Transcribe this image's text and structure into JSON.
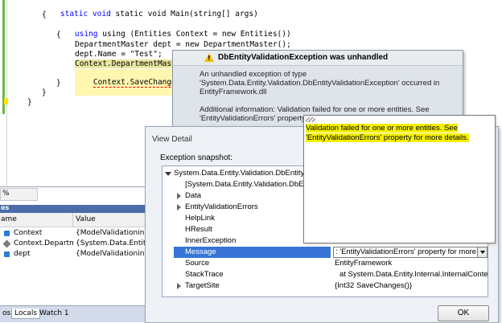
{
  "code": {
    "lines": [
      "static void Main(string[] args)",
      "{",
      "using (Entities Context = new Entities())",
      "{",
      "DepartmentMaster dept = new DepartmentMaster();",
      "dept.Name = \"Test\";",
      "Context.DepartmentMasters.Ad",
      "Context.SaveChanges();",
      "}",
      "}",
      "}"
    ]
  },
  "exception_helper": {
    "title": "DbEntityValidationException was unhandled",
    "line1": "An unhandled exception of type",
    "line2": "'System.Data.Entity.Validation.DbEntityValidationException' occurred in",
    "line3": "EntityFramework.dll",
    "line4": "Additional information: Validation failed for one or more entities. See",
    "line5": "'EntityValidationErrors' property f"
  },
  "locals": {
    "zoom": "%",
    "panel_title": "os",
    "col_name": "ame",
    "col_value": "Value",
    "rows": [
      {
        "name": "Context",
        "value": "{ModelValidationinEF("
      },
      {
        "name": "Context.Departmer",
        "value": "{System.Data.Entity.Db"
      },
      {
        "name": "dept",
        "value": "{ModelValidationinEF("
      }
    ],
    "tabs": [
      "os",
      "Locals",
      "Watch 1"
    ]
  },
  "view_detail": {
    "caption": "View Detail",
    "snapshot_label": "Exception snapshot:",
    "tree": [
      {
        "key": "System.Data.Entity.Validation.DbEntityValidat",
        "value": ""
      },
      {
        "key": "[System.Data.Entity.Validation.DbEnti",
        "value": ""
      },
      {
        "key": "Data",
        "value": ""
      },
      {
        "key": "EntityValidationErrors",
        "value": ""
      },
      {
        "key": "HelpLink",
        "value": ""
      },
      {
        "key": "HResult",
        "value": ""
      },
      {
        "key": "InnerException",
        "value": ""
      },
      {
        "key": "Message",
        "value": ": 'EntityValidationErrors' property for more details."
      },
      {
        "key": "Source",
        "value": "EntityFramework"
      },
      {
        "key": "StackTrace",
        "value": "at System.Data.Entity.Internal.InternalContext.SaveC"
      },
      {
        "key": "TargetSite",
        "value": "{Int32 SaveChanges()}"
      }
    ],
    "ok_label": "OK"
  },
  "popup": {
    "line1": "Validation failed for one or more entities. See",
    "line2": "'EntityValidationErrors' property for more details."
  }
}
